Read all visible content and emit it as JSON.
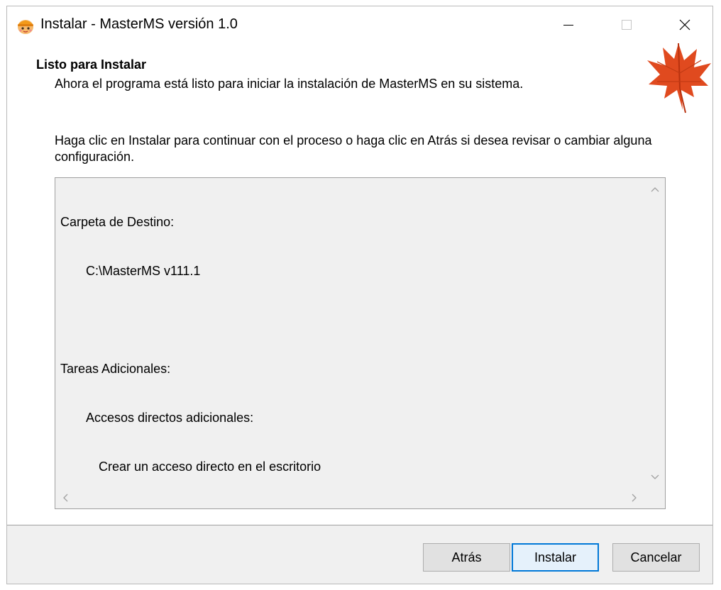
{
  "window": {
    "title": "Instalar - MasterMS versión 1.0",
    "icon": "installer-app-icon",
    "controls": {
      "minimize": "minimize-icon",
      "maximize": "maximize-icon",
      "close": "close-icon"
    }
  },
  "header": {
    "heading": "Listo para Instalar",
    "subheading": "Ahora el programa está listo para iniciar la instalación de MasterMS en su sistema.",
    "logo": "maple-leaf-icon"
  },
  "main": {
    "intro": "Haga clic en Instalar para continuar con el proceso o haga clic en Atrás si desea revisar o cambiar alguna configuración.",
    "memo": {
      "lines": [
        "Carpeta de Destino:",
        "C:\\MasterMS v111.1",
        "",
        "Tareas Adicionales:",
        "Accesos directos adicionales:",
        "Crear un acceso directo en el escritorio"
      ]
    }
  },
  "footer": {
    "back_label": "Atrás",
    "install_label": "Instalar",
    "cancel_label": "Cancelar"
  },
  "colors": {
    "accent": "#0078d7",
    "leaf": "#e04a1f",
    "panel": "#f0f0f0"
  }
}
